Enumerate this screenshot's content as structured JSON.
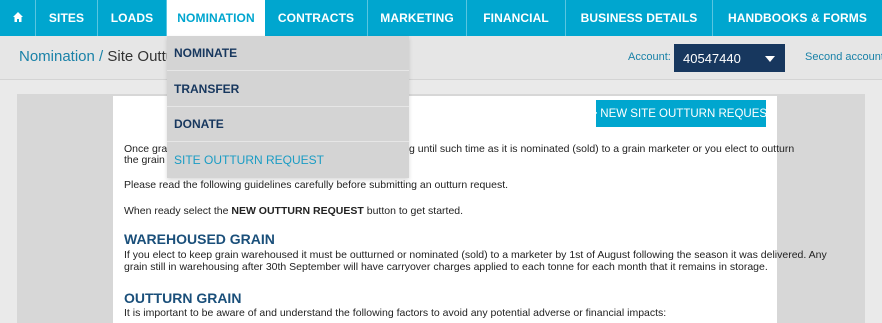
{
  "nav": {
    "items": [
      {
        "label": "SITES"
      },
      {
        "label": "LOADS"
      },
      {
        "label": "NOMINATION"
      },
      {
        "label": "CONTRACTS"
      },
      {
        "label": "MARKETING"
      },
      {
        "label": "FINANCIAL"
      },
      {
        "label": "BUSINESS DETAILS"
      },
      {
        "label": "HANDBOOKS & FORMS"
      }
    ],
    "home_icon": "home-icon"
  },
  "breadcrumb": {
    "parent": "Nomination /",
    "current": "Site Outturn"
  },
  "account": {
    "label": "Account:",
    "value": "40547440",
    "second": "Second account"
  },
  "dropdown": {
    "items": [
      {
        "label": "NOMINATE"
      },
      {
        "label": "TRANSFER"
      },
      {
        "label": "DONATE"
      },
      {
        "label": "SITE OUTTURN REQUEST"
      }
    ]
  },
  "content": {
    "new_button": "NEW SITE OUTTURN REQUEST",
    "p1_a": "Once grai",
    "p1_b": "g until such time as it is nominated (sold) to a grain marketer or you elect to outturn",
    "p1_c": "the grain f",
    "p2": "Please read the following guidelines carefully before submitting an outturn request.",
    "p3_pre": "When ready select the ",
    "p3_bold": "NEW OUTTURN REQUEST",
    "p3_post": " button to get started.",
    "h1": "WAREHOUSED GRAIN",
    "p4_1": "If you elect to keep grain warehoused it must be outturned or nominated (sold) to a marketer by 1st of August following the season it was delivered. Any",
    "p4_2": "grain still in warehousing after 30th September will have carryover charges applied to each tonne for each month that it remains in storage.",
    "h2": "OUTTURN GRAIN",
    "p5": "It is important to be aware of and understand the following factors to avoid any potential adverse or financial impacts:"
  },
  "colors": {
    "nav_bg": "#00a6cf",
    "account_bg": "#17375e",
    "heading": "#1a4f7a"
  }
}
